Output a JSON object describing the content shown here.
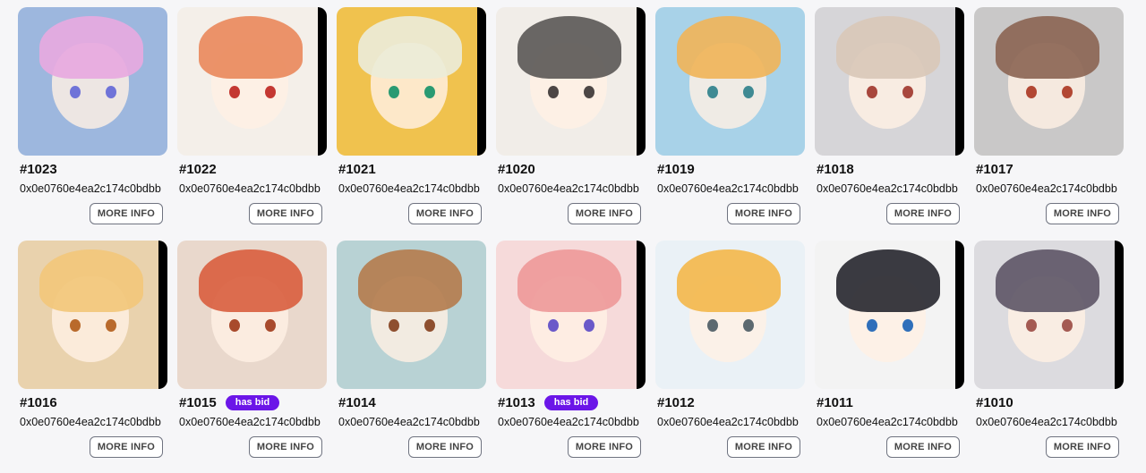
{
  "items": [
    {
      "id": "#1023",
      "address": "0x0e0760e4ea2c174c0bdbb",
      "button": "MORE INFO",
      "badge": "",
      "image": "anime-girl-pink-hair",
      "bg": "#9db7de",
      "hair": "#e7a9e0",
      "eye": "#6f73d8",
      "side_bar": false
    },
    {
      "id": "#1022",
      "address": "0x0e0760e4ea2c174c0bdbb",
      "button": "MORE INFO",
      "badge": "",
      "image": "anime-boy-orange-hair",
      "bg": "#f4efe9",
      "hair": "#e98a5d",
      "eye": "#c43832",
      "side_bar": true
    },
    {
      "id": "#1021",
      "address": "0x0e0760e4ea2c174c0bdbb",
      "button": "MORE INFO",
      "badge": "",
      "image": "anime-girl-white-hair-cat-ears",
      "bg": "#f0c24e",
      "hair": "#ebecd8",
      "eye": "#2a9a72",
      "side_bar": true
    },
    {
      "id": "#1020",
      "address": "0x0e0760e4ea2c174c0bdbb",
      "button": "MORE INFO",
      "badge": "",
      "image": "anime-girl-black-hair-horns",
      "bg": "#f1ede8",
      "hair": "#5d5a58",
      "eye": "#4c4645",
      "side_bar": true
    },
    {
      "id": "#1019",
      "address": "0x0e0760e4ea2c174c0bdbb",
      "button": "MORE INFO",
      "badge": "",
      "image": "anime-girl-blonde-hair",
      "bg": "#a8d2e8",
      "hair": "#f0b45a",
      "eye": "#3f8a93",
      "side_bar": false
    },
    {
      "id": "#1018",
      "address": "0x0e0760e4ea2c174c0bdbb",
      "button": "MORE INFO",
      "badge": "",
      "image": "anime-girl-grey-hair-fox-ears",
      "bg": "#d6d5d8",
      "hair": "#d9c8b8",
      "eye": "#a8473d",
      "side_bar": true
    },
    {
      "id": "#1017",
      "address": "0x0e0760e4ea2c174c0bdbb",
      "button": "MORE INFO",
      "badge": "",
      "image": "anime-girl-brown-hair-fox-ears",
      "bg": "#c9c8c8",
      "hair": "#8c6655",
      "eye": "#b24733",
      "side_bar": false
    },
    {
      "id": "#1016",
      "address": "0x0e0760e4ea2c174c0bdbb",
      "button": "MORE INFO",
      "badge": "",
      "image": "anime-girl-light-blonde-hair",
      "bg": "#e9d2ad",
      "hair": "#f2c77b",
      "eye": "#b96a2c",
      "side_bar": true
    },
    {
      "id": "#1015",
      "address": "0x0e0760e4ea2c174c0bdbb",
      "button": "MORE INFO",
      "badge": "has bid",
      "image": "anime-girl-red-hair-ribbon",
      "bg": "#e9d8cc",
      "hair": "#d96141",
      "eye": "#a84a2c",
      "side_bar": false
    },
    {
      "id": "#1014",
      "address": "0x0e0760e4ea2c174c0bdbb",
      "button": "MORE INFO",
      "badge": "",
      "image": "anime-girl-brown-hair-white-hat",
      "bg": "#b8d2d4",
      "hair": "#b47d4f",
      "eye": "#8e4f2f",
      "side_bar": false
    },
    {
      "id": "#1013",
      "address": "0x0e0760e4ea2c174c0bdbb",
      "button": "MORE INFO",
      "badge": "has bid",
      "image": "anime-girl-pink-long-hair",
      "bg": "#f6dada",
      "hair": "#ee9a9a",
      "eye": "#6a59c9",
      "side_bar": true
    },
    {
      "id": "#1012",
      "address": "0x0e0760e4ea2c174c0bdbb",
      "button": "MORE INFO",
      "badge": "",
      "image": "anime-girl-golden-hair-headband",
      "bg": "#eaf1f6",
      "hair": "#f3b84d",
      "eye": "#5c6970",
      "side_bar": false
    },
    {
      "id": "#1011",
      "address": "0x0e0760e4ea2c174c0bdbb",
      "button": "MORE INFO",
      "badge": "",
      "image": "anime-girl-black-long-hair",
      "bg": "#f3f3f3",
      "hair": "#2a2a32",
      "eye": "#2f6fba",
      "side_bar": true
    },
    {
      "id": "#1010",
      "address": "0x0e0760e4ea2c174c0bdbb",
      "button": "MORE INFO",
      "badge": "",
      "image": "anime-girl-dark-purple-hair-cat-ears",
      "bg": "#dcdbdf",
      "hair": "#5f5868",
      "eye": "#a45a52",
      "side_bar": true
    }
  ]
}
